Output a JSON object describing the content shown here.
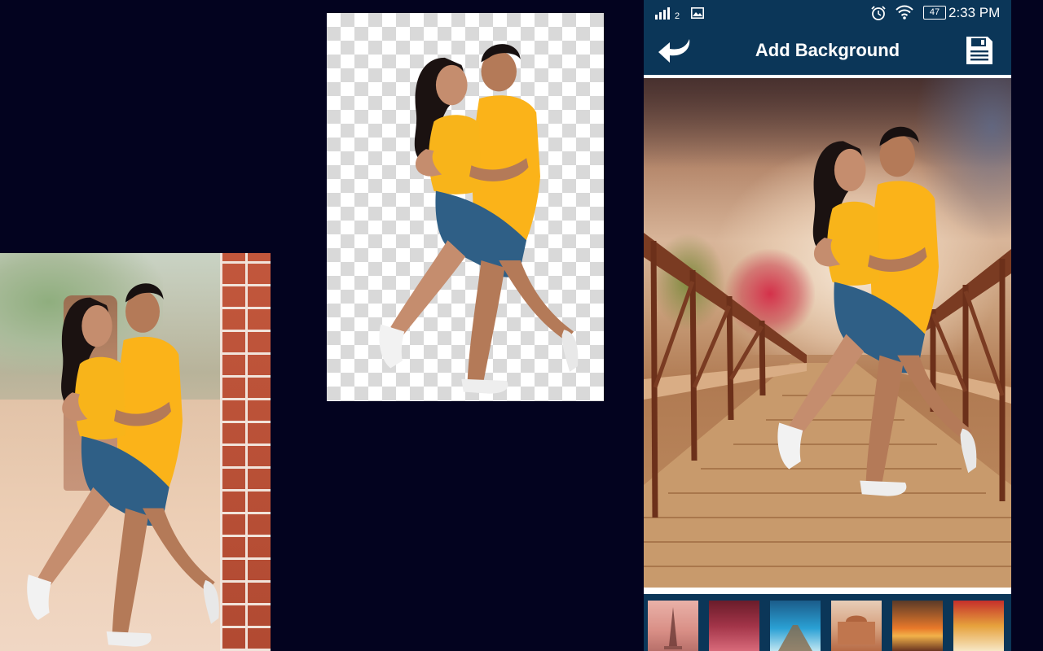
{
  "status_bar": {
    "sim_index": "2",
    "battery_level": "47",
    "time": "2:33 PM"
  },
  "app_bar": {
    "title": "Add Background"
  },
  "icons": {
    "back": "back-arrow-icon",
    "save": "save-icon",
    "signal": "signal-icon",
    "gallery": "image-icon",
    "alarm": "alarm-icon",
    "wifi": "wifi-icon",
    "battery": "battery-icon"
  },
  "background_thumbnails": [
    "eiffel-tower-thumbnail",
    "red-garden-thumbnail",
    "blue-pier-thumbnail",
    "palace-thumbnail",
    "sunset-thumbnail",
    "red-street-thumbnail"
  ],
  "colors": {
    "page_background": "#03031f",
    "app_bar": "#0b3658",
    "shirt": "#fbb319",
    "shorts": "#2f5f86"
  }
}
